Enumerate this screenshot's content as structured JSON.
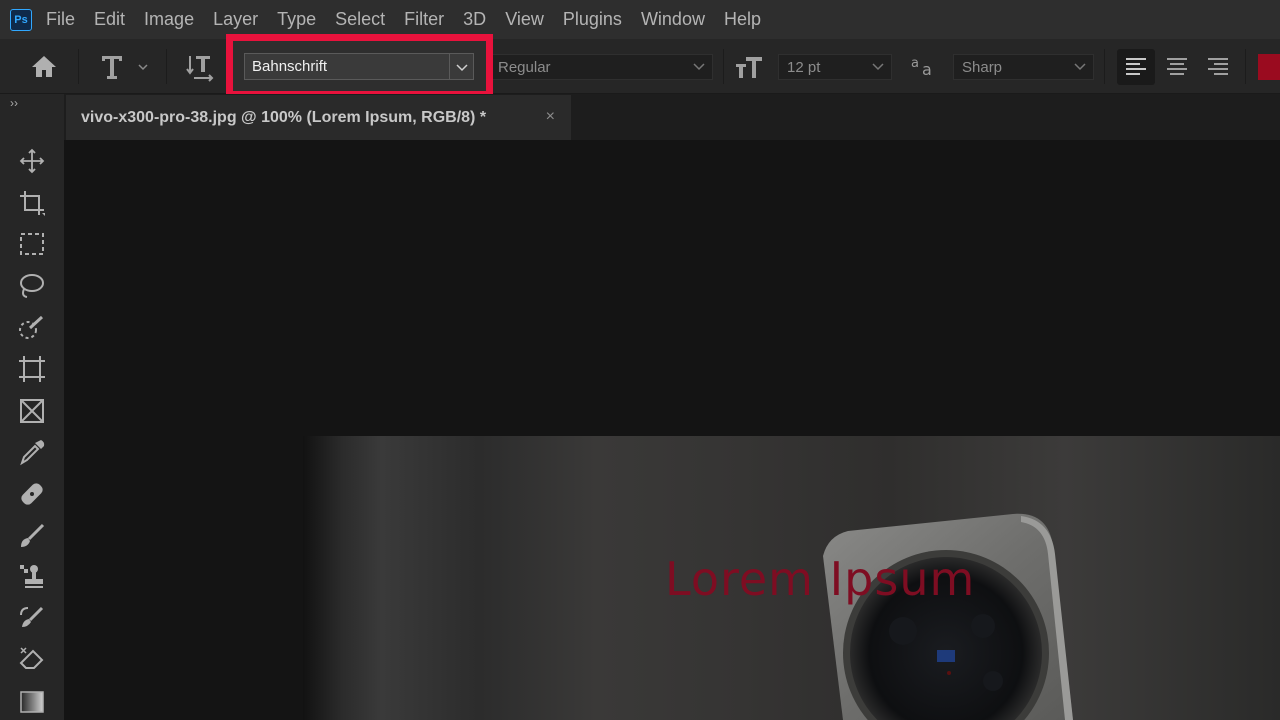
{
  "app": {
    "logo": "Ps"
  },
  "menu": [
    "File",
    "Edit",
    "Image",
    "Layer",
    "Type",
    "Select",
    "Filter",
    "3D",
    "View",
    "Plugins",
    "Window",
    "Help"
  ],
  "options": {
    "font_family": "Bahnschrift",
    "font_style": "Regular",
    "font_size": "12 pt",
    "antialias": "Sharp",
    "text_color": "#9a0b1f",
    "highlight_color": "#e8123c"
  },
  "tab": {
    "title": "vivo-x300-pro-38.jpg @ 100% (Lorem Ipsum, RGB/8) *",
    "close": "×"
  },
  "canvas": {
    "text_layer": "Lorem Ipsum"
  },
  "toolbar": {
    "collapse": "››"
  },
  "icons": [
    "home-icon",
    "type-tool-icon",
    "toggle-orientation-icon",
    "font-size-icon",
    "antialias-icon",
    "align-left-icon",
    "align-center-icon",
    "align-right-icon",
    "move-icon",
    "crop-icon",
    "marquee-icon",
    "lasso-icon",
    "quick-select-icon",
    "frame-icon",
    "frame-x-icon",
    "eyedropper-icon",
    "healing-icon",
    "brush-icon",
    "stamp-icon",
    "history-brush-icon",
    "eraser-icon",
    "gradient-icon"
  ]
}
